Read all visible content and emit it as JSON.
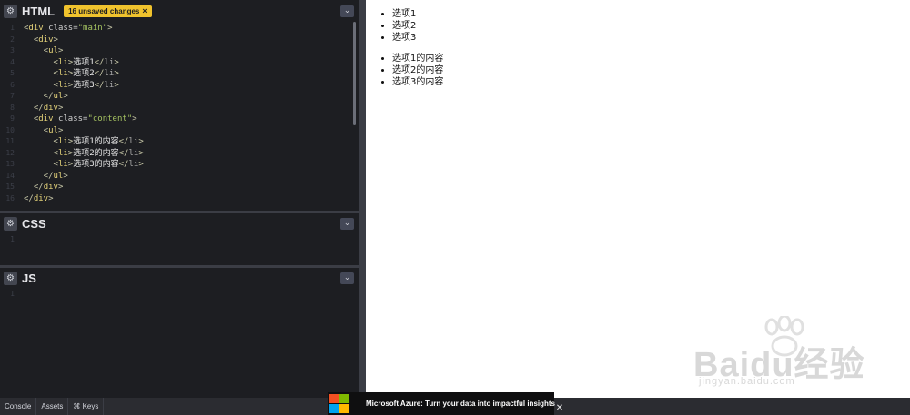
{
  "panels": {
    "html": {
      "title": "HTML",
      "badge": "16 unsaved changes",
      "badge_close": "×",
      "lines": [
        {
          "n": "1",
          "parts": [
            [
              "tag",
              "<"
            ],
            [
              "t-y",
              "div"
            ],
            [
              "attr",
              " class="
            ],
            [
              "str",
              "\"main\""
            ],
            [
              "tag",
              ">"
            ]
          ]
        },
        {
          "n": "2",
          "parts": [
            [
              "tag",
              "  <"
            ],
            [
              "t-y",
              "div"
            ],
            [
              "tag",
              ">"
            ]
          ]
        },
        {
          "n": "3",
          "parts": [
            [
              "tag",
              "    <"
            ],
            [
              "t-y",
              "ul"
            ],
            [
              "tag",
              ">"
            ]
          ]
        },
        {
          "n": "4",
          "parts": [
            [
              "tag",
              "      <"
            ],
            [
              "t-y",
              "li"
            ],
            [
              "tag",
              ">"
            ],
            [
              "txt",
              "选项1"
            ],
            [
              "tag",
              "</"
            ],
            [
              "t-g",
              "li"
            ],
            [
              "tag",
              ">"
            ]
          ]
        },
        {
          "n": "5",
          "parts": [
            [
              "tag",
              "      <"
            ],
            [
              "t-y",
              "li"
            ],
            [
              "tag",
              ">"
            ],
            [
              "txt",
              "选项2"
            ],
            [
              "tag",
              "</"
            ],
            [
              "t-g",
              "li"
            ],
            [
              "tag",
              ">"
            ]
          ]
        },
        {
          "n": "6",
          "parts": [
            [
              "tag",
              "      <"
            ],
            [
              "t-y",
              "li"
            ],
            [
              "tag",
              ">"
            ],
            [
              "txt",
              "选项3"
            ],
            [
              "tag",
              "</"
            ],
            [
              "t-g",
              "li"
            ],
            [
              "tag",
              ">"
            ]
          ]
        },
        {
          "n": "7",
          "parts": [
            [
              "tag",
              "    </"
            ],
            [
              "t-y",
              "ul"
            ],
            [
              "tag",
              ">"
            ]
          ]
        },
        {
          "n": "8",
          "parts": [
            [
              "tag",
              "  </"
            ],
            [
              "t-y",
              "div"
            ],
            [
              "tag",
              ">"
            ]
          ]
        },
        {
          "n": "9",
          "parts": [
            [
              "tag",
              "  <"
            ],
            [
              "t-y",
              "div"
            ],
            [
              "attr",
              " class="
            ],
            [
              "str",
              "\"content\""
            ],
            [
              "tag",
              ">"
            ]
          ]
        },
        {
          "n": "10",
          "parts": [
            [
              "tag",
              "    <"
            ],
            [
              "t-y",
              "ul"
            ],
            [
              "tag",
              ">"
            ]
          ]
        },
        {
          "n": "11",
          "parts": [
            [
              "tag",
              "      <"
            ],
            [
              "t-y",
              "li"
            ],
            [
              "tag",
              ">"
            ],
            [
              "txt",
              "选项1的内容"
            ],
            [
              "tag",
              "</"
            ],
            [
              "t-g",
              "li"
            ],
            [
              "tag",
              ">"
            ]
          ]
        },
        {
          "n": "12",
          "parts": [
            [
              "tag",
              "      <"
            ],
            [
              "t-y",
              "li"
            ],
            [
              "tag",
              ">"
            ],
            [
              "txt",
              "选项2的内容"
            ],
            [
              "tag",
              "</"
            ],
            [
              "t-g",
              "li"
            ],
            [
              "tag",
              ">"
            ]
          ]
        },
        {
          "n": "13",
          "parts": [
            [
              "tag",
              "      <"
            ],
            [
              "t-y",
              "li"
            ],
            [
              "tag",
              ">"
            ],
            [
              "txt",
              "选项3的内容"
            ],
            [
              "tag",
              "</"
            ],
            [
              "t-g",
              "li"
            ],
            [
              "tag",
              ">"
            ]
          ]
        },
        {
          "n": "14",
          "parts": [
            [
              "tag",
              "    </"
            ],
            [
              "t-y",
              "ul"
            ],
            [
              "tag",
              ">"
            ]
          ]
        },
        {
          "n": "15",
          "parts": [
            [
              "tag",
              "  </"
            ],
            [
              "t-y",
              "div"
            ],
            [
              "tag",
              ">"
            ]
          ]
        },
        {
          "n": "16",
          "parts": [
            [
              "tag",
              "</"
            ],
            [
              "t-y",
              "div"
            ],
            [
              "tag",
              ">"
            ]
          ]
        }
      ]
    },
    "css": {
      "title": "CSS",
      "line_number": "1"
    },
    "js": {
      "title": "JS",
      "line_number": "1"
    }
  },
  "icons": {
    "settings": "gear-icon",
    "collapse": "chevron-down-icon"
  },
  "preview": {
    "main_items": [
      "选项1",
      "选项2",
      "选项3"
    ],
    "content_items": [
      "选项1的内容",
      "选项2的内容",
      "选项3的内容"
    ]
  },
  "bottom_bar": {
    "console": "Console",
    "assets": "Assets",
    "keys": "⌘ Keys"
  },
  "ad": {
    "text": "Microsoft Azure: Turn your data into impactful insights",
    "close": "✕"
  },
  "watermark": {
    "brand": "Baidu经验",
    "url": "jingyan.baidu.com"
  },
  "colors": {
    "editor_bg": "#1d1e22",
    "badge": "#f0c32d",
    "tag": "#e6d47a",
    "string": "#a5c261"
  }
}
